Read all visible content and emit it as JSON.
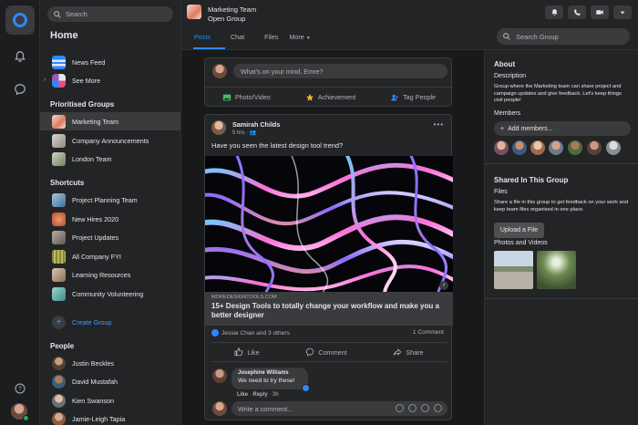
{
  "search": {
    "placeholder": "Search"
  },
  "home": {
    "title": "Home"
  },
  "nav": [
    {
      "label": "News Feed"
    },
    {
      "label": "See More"
    }
  ],
  "prioritised": {
    "title": "Prioritised Groups",
    "items": [
      {
        "label": "Marketing Team",
        "active": true
      },
      {
        "label": "Company Announcements"
      },
      {
        "label": "London Team"
      }
    ]
  },
  "shortcuts": {
    "title": "Shortcuts",
    "items": [
      {
        "label": "Project Planning Team"
      },
      {
        "label": "New Hires 2020"
      },
      {
        "label": "Project Updates"
      },
      {
        "label": "All Company FYI"
      },
      {
        "label": "Learning Resources"
      },
      {
        "label": "Community Volunteering"
      }
    ],
    "create": "Create Group"
  },
  "people": {
    "title": "People",
    "items": [
      {
        "label": "Justin Beckles"
      },
      {
        "label": "David Mustafah"
      },
      {
        "label": "Kien Swanson"
      },
      {
        "label": "Jamie-Leigh Tapia"
      }
    ]
  },
  "group": {
    "name": "Marketing Team",
    "type": "Open Group",
    "tabs": [
      "Posts",
      "Chat",
      "Files",
      "More"
    ],
    "search_placeholder": "Search Group"
  },
  "composer": {
    "placeholder": "What's on your mind, Emre?",
    "actions": [
      "Photo/Video",
      "Achievement",
      "Tag People"
    ]
  },
  "post": {
    "author": "Samirah Childs",
    "time": "5 hrs ·",
    "text": "Have you seen the latest design tool trend?",
    "link_domain": "MOREDESIGNTOOLS.COM",
    "link_title": "15+ Design Tools to totally change your workflow and make you a better designer",
    "reactions": "Jessie Chan and 3 others",
    "comments_count": "1 Comment",
    "actions": [
      "Like",
      "Comment",
      "Share"
    ],
    "comment": {
      "author": "Josephine Williams",
      "text": "We need to try these!",
      "like": "Like",
      "reply": "Reply",
      "time": "3h"
    },
    "write_placeholder": "Write a comment..."
  },
  "about": {
    "title": "About",
    "description_label": "Description",
    "description": "Group where the Marketing team can share project and campaign updates and give feedback. Let's keep things civil people!",
    "members_label": "Members",
    "add_members": "Add members..."
  },
  "shared": {
    "title": "Shared In This Group",
    "files_label": "Files",
    "files_text": "Share a file in this group to get feedback on your work and keep team files organised in one place.",
    "upload": "Upload a File",
    "photos_label": "Photos and Videos"
  },
  "colors": {
    "accent": "#2d88ff",
    "background": "#18191a",
    "panel": "#232425"
  }
}
